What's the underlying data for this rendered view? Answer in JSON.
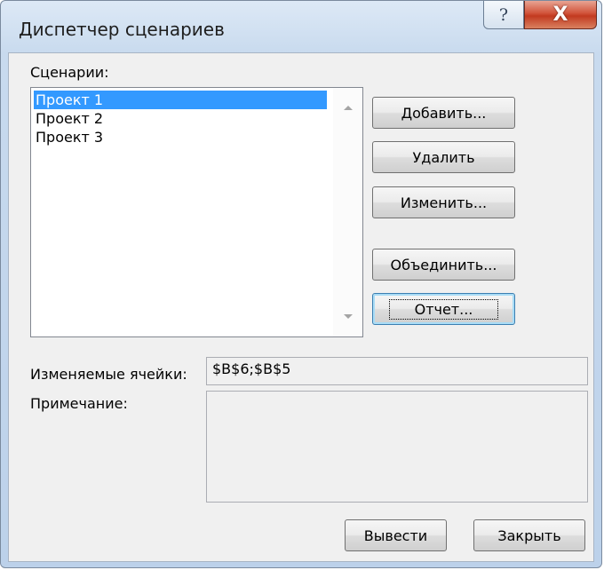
{
  "window": {
    "title": "Диспетчер сценариев",
    "help_label": "?",
    "close_label": "X"
  },
  "scenarios": {
    "label": "Сценарии:",
    "items": [
      {
        "label": "Проект 1",
        "selected": true
      },
      {
        "label": "Проект 2",
        "selected": false
      },
      {
        "label": "Проект 3",
        "selected": false
      }
    ]
  },
  "buttons": {
    "add": "Добавить...",
    "delete": "Удалить",
    "edit": "Изменить...",
    "merge": "Объединить...",
    "report": "Отчет...",
    "show": "Вывести",
    "close": "Закрыть"
  },
  "fields": {
    "changing_cells_label": "Изменяемые ячейки:",
    "changing_cells_value": "$B$6;$B$5",
    "comment_label": "Примечание:",
    "comment_value": ""
  },
  "colors": {
    "selection": "#3399ff",
    "close_button": "#c23a20"
  }
}
